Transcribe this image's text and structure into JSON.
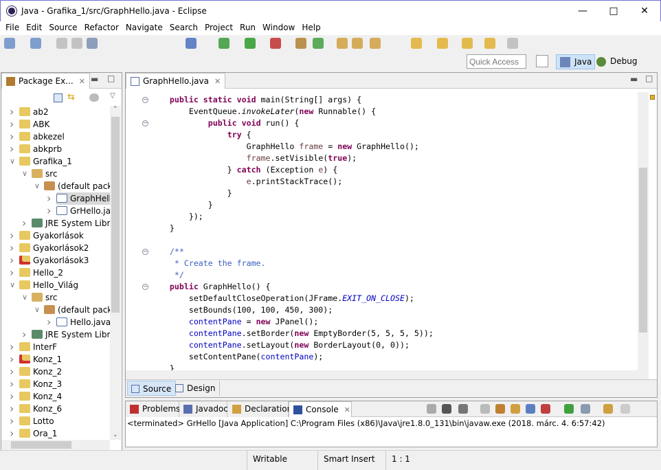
{
  "window": {
    "title": "Java - Grafika_1/src/GraphHello.java - Eclipse"
  },
  "menu": [
    "File",
    "Edit",
    "Source",
    "Refactor",
    "Navigate",
    "Search",
    "Project",
    "Run",
    "Window",
    "Help"
  ],
  "quick_access": {
    "placeholder": "Quick Access"
  },
  "perspectives": [
    {
      "label": "Java",
      "active": true
    },
    {
      "label": "Debug",
      "active": false
    }
  ],
  "package_explorer": {
    "title": "Package Ex...",
    "items": [
      {
        "label": "ab2",
        "level": 0,
        "state": "collapsed",
        "type": "project"
      },
      {
        "label": "ABK",
        "level": 0,
        "state": "collapsed",
        "type": "project-warn"
      },
      {
        "label": "abkezel",
        "level": 0,
        "state": "collapsed",
        "type": "project-warn"
      },
      {
        "label": "abkprb",
        "level": 0,
        "state": "collapsed",
        "type": "project"
      },
      {
        "label": "Grafika_1",
        "level": 0,
        "state": "expanded",
        "type": "project-warn"
      },
      {
        "label": "src",
        "level": 1,
        "state": "expanded",
        "type": "src"
      },
      {
        "label": "(default package)",
        "level": 2,
        "state": "expanded",
        "type": "package"
      },
      {
        "label": "GraphHello.java",
        "level": 3,
        "state": "collapsed",
        "type": "java",
        "selected": true
      },
      {
        "label": "GrHello.java",
        "level": 3,
        "state": "collapsed",
        "type": "java"
      },
      {
        "label": "JRE System Library",
        "level": 1,
        "state": "collapsed",
        "type": "library"
      },
      {
        "label": "Gyakorlások",
        "level": 0,
        "state": "collapsed",
        "type": "project-warn"
      },
      {
        "label": "Gyakorlások2",
        "level": 0,
        "state": "collapsed",
        "type": "project-warn"
      },
      {
        "label": "Gyakorlások3",
        "level": 0,
        "state": "collapsed",
        "type": "project-error"
      },
      {
        "label": "Hello_2",
        "level": 0,
        "state": "collapsed",
        "type": "project-warn"
      },
      {
        "label": "Hello_Világ",
        "level": 0,
        "state": "expanded",
        "type": "project-warn"
      },
      {
        "label": "src",
        "level": 1,
        "state": "expanded",
        "type": "src"
      },
      {
        "label": "(default package)",
        "level": 2,
        "state": "expanded",
        "type": "package"
      },
      {
        "label": "Hello.java",
        "level": 3,
        "state": "collapsed",
        "type": "java"
      },
      {
        "label": "JRE System Library",
        "level": 1,
        "state": "collapsed",
        "type": "library"
      },
      {
        "label": "InterF",
        "level": 0,
        "state": "collapsed",
        "type": "project"
      },
      {
        "label": "Konz_1",
        "level": 0,
        "state": "collapsed",
        "type": "project-error"
      },
      {
        "label": "Konz_2",
        "level": 0,
        "state": "collapsed",
        "type": "project-warn"
      },
      {
        "label": "Konz_3",
        "level": 0,
        "state": "collapsed",
        "type": "project-warn"
      },
      {
        "label": "Konz_4",
        "level": 0,
        "state": "collapsed",
        "type": "project-warn"
      },
      {
        "label": "Konz_6",
        "level": 0,
        "state": "collapsed",
        "type": "project-warn"
      },
      {
        "label": "Lotto",
        "level": 0,
        "state": "collapsed",
        "type": "project-warn"
      },
      {
        "label": "Ora_1",
        "level": 0,
        "state": "collapsed",
        "type": "project-warn"
      }
    ]
  },
  "editor": {
    "tab": "GraphHello.java",
    "lines": [
      [
        [
          "    "
        ],
        [
          "public static void ",
          "k"
        ],
        [
          "main(String[] args) {"
        ]
      ],
      [
        [
          "        EventQueue."
        ],
        [
          "invokeLater",
          "i"
        ],
        [
          "("
        ],
        [
          "new ",
          "k"
        ],
        [
          "Runnable() {"
        ]
      ],
      [
        [
          "            "
        ],
        [
          "public void ",
          "k"
        ],
        [
          "run() {"
        ]
      ],
      [
        [
          "                "
        ],
        [
          "try ",
          "k"
        ],
        [
          "{"
        ]
      ],
      [
        [
          "                    GraphHello "
        ],
        [
          "frame",
          "v"
        ],
        [
          " = "
        ],
        [
          "new ",
          "k"
        ],
        [
          "GraphHello();"
        ]
      ],
      [
        [
          "                    "
        ],
        [
          "frame",
          "v"
        ],
        [
          ".setVisible("
        ],
        [
          "true",
          "k"
        ],
        [
          ");"
        ]
      ],
      [
        [
          "                } "
        ],
        [
          "catch ",
          "k"
        ],
        [
          "(Exception "
        ],
        [
          "e",
          "v"
        ],
        [
          ") {"
        ]
      ],
      [
        [
          "                    "
        ],
        [
          "e",
          "v"
        ],
        [
          ".printStackTrace();"
        ]
      ],
      [
        [
          "                }"
        ]
      ],
      [
        [
          "            }"
        ]
      ],
      [
        [
          "        });"
        ]
      ],
      [
        [
          "    }"
        ]
      ],
      [
        [
          ""
        ]
      ],
      [
        [
          "    "
        ],
        [
          "/**",
          "c"
        ]
      ],
      [
        [
          "     * Create the frame.",
          "c"
        ]
      ],
      [
        [
          "     */",
          "c"
        ]
      ],
      [
        [
          "    "
        ],
        [
          "public ",
          "k"
        ],
        [
          "GraphHello() {"
        ]
      ],
      [
        [
          "        setDefaultCloseOperation(JFrame."
        ],
        [
          "EXIT_ON_CLOSE",
          "fi"
        ],
        [
          ");"
        ]
      ],
      [
        [
          "        setBounds(100, 100, 450, 300);"
        ]
      ],
      [
        [
          "        "
        ],
        [
          "contentPane",
          "f"
        ],
        [
          " = "
        ],
        [
          "new ",
          "k"
        ],
        [
          "JPanel();"
        ]
      ],
      [
        [
          "        "
        ],
        [
          "contentPane",
          "f"
        ],
        [
          ".setBorder("
        ],
        [
          "new ",
          "k"
        ],
        [
          "EmptyBorder(5, 5, 5, 5));"
        ]
      ],
      [
        [
          "        "
        ],
        [
          "contentPane",
          "f"
        ],
        [
          ".setLayout("
        ],
        [
          "new ",
          "k"
        ],
        [
          "BorderLayout(0, 0));"
        ]
      ],
      [
        [
          "        setContentPane("
        ],
        [
          "contentPane",
          "f"
        ],
        [
          ");"
        ]
      ],
      [
        [
          "    }"
        ]
      ]
    ],
    "fold_lines": [
      0,
      2,
      13,
      16
    ],
    "bottom_tabs": [
      "Source",
      "Design"
    ]
  },
  "console": {
    "tabs": [
      "Problems",
      "Javadoc",
      "Declaration",
      "Console"
    ],
    "active_tab": "Console",
    "text": "<terminated> GrHello [Java Application] C:\\Program Files (x86)\\Java\\jre1.8.0_131\\bin\\javaw.exe (2018. márc. 4. 6:57:42)"
  },
  "status": {
    "mode": "Writable",
    "insert": "Smart Insert",
    "position": "1 : 1"
  }
}
